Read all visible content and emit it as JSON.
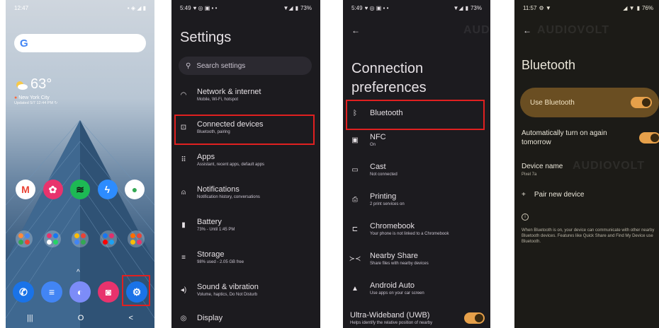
{
  "watermark": "AUDIOVOLT",
  "panel1": {
    "status": {
      "time": "12:47",
      "icons": "▪︎ ◈ ◢ ▮"
    },
    "search": {
      "logo": "G"
    },
    "weather": {
      "temp": "63°",
      "city": "New York City",
      "updated": "Updated 5/7 12:44 PM"
    },
    "apps": [
      "Gmail",
      "Flower",
      "Spotify",
      "Messenger",
      "Maps"
    ],
    "dock": [
      "Phone",
      "Messages",
      "Browser",
      "Camera",
      "Settings"
    ],
    "nav": [
      "|||",
      "O",
      "<"
    ]
  },
  "panel2": {
    "status": {
      "time": "5:49",
      "battery": "73%"
    },
    "title": "Settings",
    "search_placeholder": "Search settings",
    "items": [
      {
        "title": "Network & internet",
        "sub": "Mobile, Wi-Fi, hotspot",
        "icon": "wifi-icon",
        "glyph": "◠"
      },
      {
        "title": "Connected devices",
        "sub": "Bluetooth, pairing",
        "icon": "devices-icon",
        "glyph": "⊡"
      },
      {
        "title": "Apps",
        "sub": "Assistant, recent apps, default apps",
        "icon": "apps-grid-icon",
        "glyph": "⠿"
      },
      {
        "title": "Notifications",
        "sub": "Notification history, conversations",
        "icon": "bell-icon",
        "glyph": "⍝"
      },
      {
        "title": "Battery",
        "sub": "73% - Until 1:45 PM",
        "icon": "battery-icon",
        "glyph": "▮"
      },
      {
        "title": "Storage",
        "sub": "98% used - 2.05 GB free",
        "icon": "storage-icon",
        "glyph": "≡"
      },
      {
        "title": "Sound & vibration",
        "sub": "Volume, haptics, Do Not Disturb",
        "icon": "speaker-icon",
        "glyph": "◂)"
      },
      {
        "title": "Display",
        "sub": "",
        "icon": "display-icon",
        "glyph": "◎"
      }
    ]
  },
  "panel3": {
    "status": {
      "time": "5:49",
      "battery": "73%"
    },
    "title_line1": "Connection",
    "title_line2": "preferences",
    "items": [
      {
        "title": "Bluetooth",
        "sub": "",
        "icon": "bluetooth-icon",
        "glyph": "ᛒ"
      },
      {
        "title": "NFC",
        "sub": "On",
        "icon": "nfc-icon",
        "glyph": "▣"
      },
      {
        "title": "Cast",
        "sub": "Not connected",
        "icon": "cast-icon",
        "glyph": "▭"
      },
      {
        "title": "Printing",
        "sub": "2 print services on",
        "icon": "printer-icon",
        "glyph": "⎙"
      },
      {
        "title": "Chromebook",
        "sub": "Your phone is not linked to a Chromebook",
        "icon": "laptop-icon",
        "glyph": "⊏"
      },
      {
        "title": "Nearby Share",
        "sub": "Share files with nearby devices",
        "icon": "nearby-share-icon",
        "glyph": "≻≺"
      },
      {
        "title": "Android Auto",
        "sub": "Use apps on your car screen",
        "icon": "android-auto-icon",
        "glyph": "▲"
      },
      {
        "title": "Ultra-Wideband (UWB)",
        "sub": "Helps identify the relative position of nearby",
        "icon": "",
        "glyph": ""
      }
    ]
  },
  "panel4": {
    "status": {
      "time": "11:57",
      "battery": "76%"
    },
    "title": "Bluetooth",
    "use_bt": "Use Bluetooth",
    "auto_turn_on": "Automatically turn on again tomorrow",
    "device_name_label": "Device name",
    "device_name_value": "Pixel 7a",
    "pair_new": "Pair new device",
    "note": "When Bluetooth is on, your device can communicate with other nearby Bluetooth devices. Features like Quick Share and Find My Device use Bluetooth."
  },
  "colors": {
    "highlight": "#e02020",
    "toggle": "#e6a04a",
    "use_bt_bg": "#6a4e22"
  }
}
